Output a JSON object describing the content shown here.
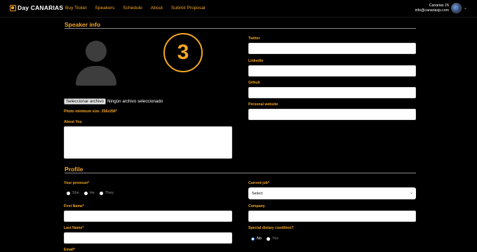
{
  "header": {
    "logo_text": "Day CANARIAS",
    "nav": [
      "Buy Ticket",
      "Speakers",
      "Schedule",
      "About",
      "Submit Proposal"
    ],
    "user_name": "Canarias JS",
    "user_email": "info@canariasjs.com"
  },
  "speaker": {
    "title": "Speaker info",
    "step_number": "3",
    "file_button": "Seleccionar archivo",
    "file_status": "Ningún archivo seleccionado",
    "photo_note": "Photo minimum size: 256x256*",
    "about_label": "About You",
    "twitter_label": "Twitter",
    "linkedin_label": "Linkedin",
    "github_label": "Github",
    "website_label": "Personal website"
  },
  "profile": {
    "title": "Profile",
    "pronoun_label": "Your pronoun*",
    "pronouns": [
      "She",
      "He",
      "They"
    ],
    "first_name_label": "First Name*",
    "last_name_label": "Last Name*",
    "email_label": "Email*",
    "current_job_label": "Current job*",
    "current_job_value": "Select",
    "company_label": "Company",
    "dietary_label": "Special dietary condition?",
    "dietary_options": [
      "No",
      "Yes"
    ],
    "dietary_selected": "No"
  },
  "colors": {
    "accent": "#f5a623",
    "background": "#000000",
    "input_bg": "#ffffff"
  }
}
